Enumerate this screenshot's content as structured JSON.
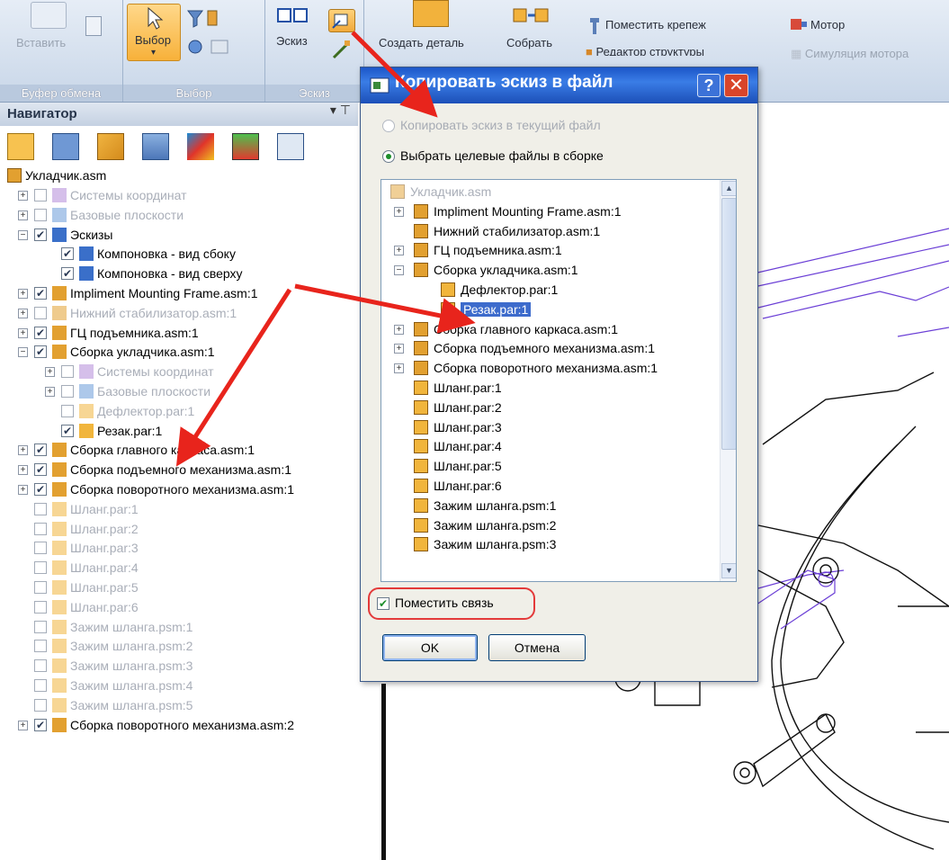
{
  "ribbon": {
    "clipboard": {
      "paste_label": "Вставить",
      "group_label": "Буфер обмена"
    },
    "select": {
      "select_label": "Выбор",
      "group_label": "Выбор"
    },
    "sketch": {
      "sketch_label": "Эскиз",
      "group_label": "Эскиз"
    },
    "assemble": {
      "create_part_label": "Создать деталь",
      "assemble_label": "Собрать",
      "place_fastener_label": "Поместить крепеж",
      "structure_editor_label": "Редактор структуры"
    },
    "motor": {
      "motor_label": "Мотор",
      "motor_sim_label": "Симуляция мотора"
    }
  },
  "navigator": {
    "title": "Навигатор",
    "pin": "▾ ⊤",
    "root": "Укладчик.asm",
    "items": [
      {
        "label": "Системы координат",
        "dim": true
      },
      {
        "label": "Базовые плоскости",
        "dim": true
      },
      {
        "label": "Эскизы"
      },
      {
        "label": "Компоновка - вид сбоку"
      },
      {
        "label": "Компоновка - вид сверху"
      },
      {
        "label": "Impliment Mounting Frame.asm:1"
      },
      {
        "label": "Нижний стабилизатор.asm:1",
        "dim": true
      },
      {
        "label": "ГЦ подъемника.asm:1"
      },
      {
        "label": "Сборка укладчика.asm:1"
      },
      {
        "label": "Системы координат",
        "dim": true
      },
      {
        "label": "Базовые плоскости",
        "dim": true
      },
      {
        "label": "Дефлектор.par:1",
        "dim": true
      },
      {
        "label": "Резак.par:1"
      },
      {
        "label": "Сборка главного каркаса.asm:1"
      },
      {
        "label": "Сборка подъемного механизма.asm:1"
      },
      {
        "label": "Сборка поворотного механизма.asm:1"
      },
      {
        "label": "Шланг.par:1",
        "dim": true
      },
      {
        "label": "Шланг.par:2",
        "dim": true
      },
      {
        "label": "Шланг.par:3",
        "dim": true
      },
      {
        "label": "Шланг.par:4",
        "dim": true
      },
      {
        "label": "Шланг.par:5",
        "dim": true
      },
      {
        "label": "Шланг.par:6",
        "dim": true
      },
      {
        "label": "Зажим шланга.psm:1",
        "dim": true
      },
      {
        "label": "Зажим шланга.psm:2",
        "dim": true
      },
      {
        "label": "Зажим шланга.psm:3",
        "dim": true
      },
      {
        "label": "Зажим шланга.psm:4",
        "dim": true
      },
      {
        "label": "Зажим шланга.psm:5",
        "dim": true
      },
      {
        "label": "Сборка поворотного механизма.asm:2"
      }
    ]
  },
  "dialog": {
    "title": "Копировать эскиз в файл",
    "help": "?",
    "close": "✕",
    "radio_current": "Копировать эскиз в текущий файл",
    "radio_targets": "Выбрать целевые файлы в сборке",
    "files": [
      {
        "label": "Укладчик.asm",
        "dim": true
      },
      {
        "label": "Impliment Mounting Frame.asm:1"
      },
      {
        "label": "Нижний стабилизатор.asm:1"
      },
      {
        "label": "ГЦ подъемника.asm:1"
      },
      {
        "label": "Сборка укладчика.asm:1"
      },
      {
        "label": "Дефлектор.par:1"
      },
      {
        "label": "Резак.par:1",
        "selected": true
      },
      {
        "label": "Сборка главного каркаса.asm:1"
      },
      {
        "label": "Сборка подъемного механизма.asm:1"
      },
      {
        "label": "Сборка поворотного механизма.asm:1"
      },
      {
        "label": "Шланг.par:1"
      },
      {
        "label": "Шланг.par:2"
      },
      {
        "label": "Шланг.par:3"
      },
      {
        "label": "Шланг.par:4"
      },
      {
        "label": "Шланг.par:5"
      },
      {
        "label": "Шланг.par:6"
      },
      {
        "label": "Зажим шланга.psm:1"
      },
      {
        "label": "Зажим шланга.psm:2"
      },
      {
        "label": "Зажим шланга.psm:3"
      }
    ],
    "place_link_label": "Поместить связь",
    "ok_label": "OK",
    "cancel_label": "Отмена"
  },
  "colors": {
    "annotation_arrow": "#e8241c",
    "selection": "#3d6bcc",
    "sketch_line": "#6b3fd6"
  }
}
